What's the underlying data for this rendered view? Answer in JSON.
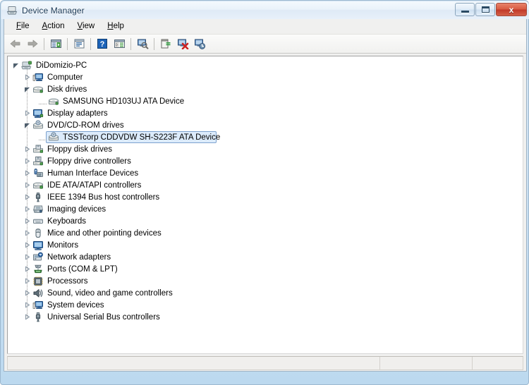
{
  "window": {
    "title": "Device Manager",
    "icon": "device-manager-icon",
    "controls": {
      "minimize_label": "Minimize",
      "maximize_label": "Maximize",
      "close_label": "Close",
      "close_glyph": "x"
    }
  },
  "menubar": {
    "items": [
      {
        "label": "File",
        "accel": "F"
      },
      {
        "label": "Action",
        "accel": "A"
      },
      {
        "label": "View",
        "accel": "V"
      },
      {
        "label": "Help",
        "accel": "H"
      }
    ]
  },
  "toolbar": {
    "buttons": [
      {
        "name": "back-button",
        "icon": "back-arrow-icon",
        "label": "Back"
      },
      {
        "name": "forward-button",
        "icon": "forward-arrow-icon",
        "label": "Forward"
      },
      {
        "name": "show-hide-console-tree-button",
        "icon": "console-tree-icon",
        "label": "Show/Hide Console Tree"
      },
      {
        "name": "properties-button",
        "icon": "properties-icon",
        "label": "Properties"
      },
      {
        "name": "help-button",
        "icon": "help-question-icon",
        "label": "Help"
      },
      {
        "name": "show-hide-action-pane-button",
        "icon": "action-pane-icon",
        "label": "Show/Hide Action Pane"
      },
      {
        "name": "scan-for-hardware-changes-button",
        "icon": "scan-hardware-icon",
        "label": "Scan for hardware changes"
      },
      {
        "name": "update-driver-button",
        "icon": "update-driver-icon",
        "label": "Update Driver Software"
      },
      {
        "name": "disable-device-button",
        "icon": "disable-device-icon",
        "label": "Disable"
      },
      {
        "name": "uninstall-device-button",
        "icon": "uninstall-device-icon",
        "label": "Uninstall"
      }
    ]
  },
  "tree": {
    "nodes": [
      {
        "label": "DiDomizio-PC",
        "depth": 0,
        "state": "expanded",
        "icon": "computer-root-icon",
        "selected": false
      },
      {
        "label": "Computer",
        "depth": 1,
        "state": "collapsed",
        "icon": "computer-icon",
        "selected": false
      },
      {
        "label": "Disk drives",
        "depth": 1,
        "state": "expanded",
        "icon": "disk-drive-icon",
        "selected": false
      },
      {
        "label": "SAMSUNG HD103UJ ATA Device",
        "depth": 2,
        "state": "leaf",
        "icon": "disk-drive-icon",
        "selected": false
      },
      {
        "label": "Display adapters",
        "depth": 1,
        "state": "collapsed",
        "icon": "display-adapter-icon",
        "selected": false
      },
      {
        "label": "DVD/CD-ROM drives",
        "depth": 1,
        "state": "expanded",
        "icon": "dvd-drive-icon",
        "selected": false
      },
      {
        "label": "TSSTcorp CDDVDW SH-S223F ATA Device",
        "depth": 2,
        "state": "leaf",
        "icon": "dvd-drive-icon",
        "selected": true
      },
      {
        "label": "Floppy disk drives",
        "depth": 1,
        "state": "collapsed",
        "icon": "floppy-disk-icon",
        "selected": false
      },
      {
        "label": "Floppy drive controllers",
        "depth": 1,
        "state": "collapsed",
        "icon": "floppy-controller-icon",
        "selected": false
      },
      {
        "label": "Human Interface Devices",
        "depth": 1,
        "state": "collapsed",
        "icon": "hid-icon",
        "selected": false
      },
      {
        "label": "IDE ATA/ATAPI controllers",
        "depth": 1,
        "state": "collapsed",
        "icon": "ide-controller-icon",
        "selected": false
      },
      {
        "label": "IEEE 1394 Bus host controllers",
        "depth": 1,
        "state": "collapsed",
        "icon": "ieee1394-icon",
        "selected": false
      },
      {
        "label": "Imaging devices",
        "depth": 1,
        "state": "collapsed",
        "icon": "imaging-device-icon",
        "selected": false
      },
      {
        "label": "Keyboards",
        "depth": 1,
        "state": "collapsed",
        "icon": "keyboard-icon",
        "selected": false
      },
      {
        "label": "Mice and other pointing devices",
        "depth": 1,
        "state": "collapsed",
        "icon": "mouse-icon",
        "selected": false
      },
      {
        "label": "Monitors",
        "depth": 1,
        "state": "collapsed",
        "icon": "monitor-icon",
        "selected": false
      },
      {
        "label": "Network adapters",
        "depth": 1,
        "state": "collapsed",
        "icon": "network-adapter-icon",
        "selected": false
      },
      {
        "label": "Ports (COM & LPT)",
        "depth": 1,
        "state": "collapsed",
        "icon": "port-icon",
        "selected": false
      },
      {
        "label": "Processors",
        "depth": 1,
        "state": "collapsed",
        "icon": "processor-icon",
        "selected": false
      },
      {
        "label": "Sound, video and game controllers",
        "depth": 1,
        "state": "collapsed",
        "icon": "sound-controller-icon",
        "selected": false
      },
      {
        "label": "System devices",
        "depth": 1,
        "state": "collapsed",
        "icon": "system-device-icon",
        "selected": false
      },
      {
        "label": "Universal Serial Bus controllers",
        "depth": 1,
        "state": "collapsed",
        "icon": "usb-controller-icon",
        "selected": false
      }
    ]
  },
  "statusbar": {
    "segments": [
      "",
      "",
      ""
    ]
  },
  "colors": {
    "selection_fill": "#dcebfb",
    "selection_border": "#7da2ce",
    "title_text": "#1b3a57",
    "close_button": "#c0392a",
    "window_glass": "#bcd9ef"
  }
}
